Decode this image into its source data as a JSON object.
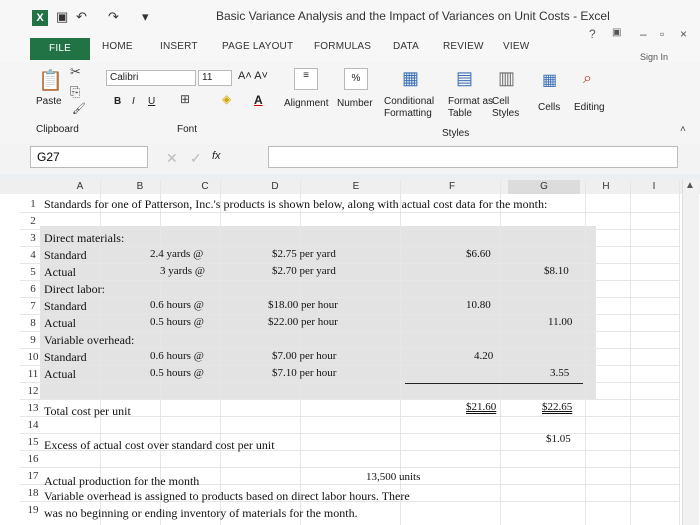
{
  "window": {
    "title": "Basic Variance Analysis and the Impact of Variances on Unit Costs - Excel",
    "help": "?",
    "controls": [
      "–",
      "×"
    ]
  },
  "tabs": [
    "FILE",
    "HOME",
    "INSERT",
    "PAGE LAYOUT",
    "FORMULAS",
    "DATA",
    "REVIEW",
    "VIEW"
  ],
  "sign_in": "Sign In",
  "ribbon": {
    "paste": "Paste",
    "clipboard": "Clipboard",
    "font_name": "Calibri",
    "font_size": "11",
    "bold": "B",
    "italic": "I",
    "underline": "U",
    "font_group": "Font",
    "alignment": "Alignment",
    "number": "Number",
    "percent": "%",
    "conditional_formatting": "Conditional Formatting",
    "format_as_table": "Format as Table",
    "cell_styles": "Cell Styles",
    "styles_group": "Styles",
    "cells": "Cells",
    "editing": "Editing"
  },
  "formula_bar": {
    "name_box": "G27",
    "fx": "fx",
    "formula": ""
  },
  "columns": [
    "A",
    "B",
    "C",
    "D",
    "E",
    "F",
    "G",
    "H",
    "I"
  ],
  "rows": [
    "1",
    "2",
    "3",
    "4",
    "5",
    "6",
    "7",
    "8",
    "9",
    "10",
    "11",
    "12",
    "13",
    "14",
    "15",
    "16",
    "17",
    "18",
    "19"
  ],
  "cells": {
    "r1": "Standards for one of Patterson, Inc.'s products is shown below, along with actual cost data for the month:",
    "r3": "Direct materials:",
    "r4": "Standard",
    "r4_qty": "2.4 yards @",
    "r4_rate": "$2.75 per yard",
    "r4_std": "$6.60",
    "r5": "Actual",
    "r5_qty": "3 yards @",
    "r5_rate": "$2.70 per yard",
    "r5_act": "$8.10",
    "r6": "Direct labor:",
    "r7": "Standard",
    "r7_qty": "0.6 hours @",
    "r7_rate": "$18.00 per hour",
    "r7_std": "10.80",
    "r8": "Actual",
    "r8_qty": "0.5 hours @",
    "r8_rate": "$22.00 per hour",
    "r8_act": "11.00",
    "r9": "Variable overhead:",
    "r10": "Standard",
    "r10_qty": "0.6 hours @",
    "r10_rate": "$7.00 per hour",
    "r10_std": "4.20",
    "r11": "Actual",
    "r11_qty": "0.5 hours @",
    "r11_rate": "$7.10 per hour",
    "r11_act": "3.55",
    "r13": "Total cost per unit",
    "r13_std": "$21.60",
    "r13_act": "$22.65",
    "r15": "Excess of actual cost over standard cost per unit",
    "r15_val": "$1.05",
    "r17": "Actual production for the month",
    "r17_val": "13,500 units",
    "r18": "Variable overhead is assigned to products based on direct labor hours. There",
    "r19": "was no beginning or ending inventory of materials for the month."
  }
}
